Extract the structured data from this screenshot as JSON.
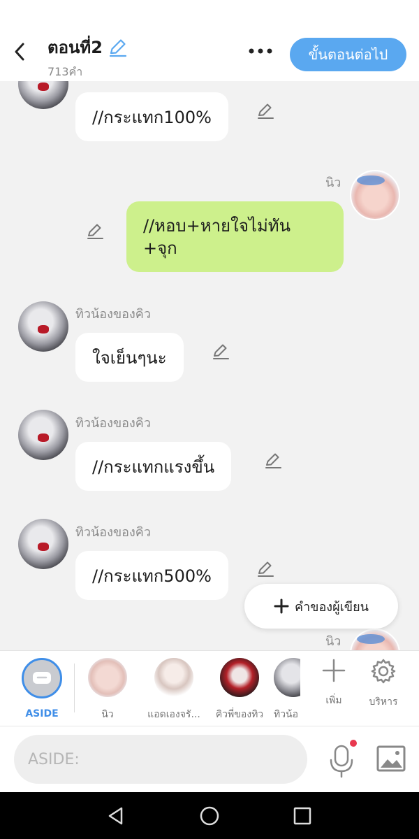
{
  "header": {
    "title": "ตอนที่2",
    "word_count": "713คำ",
    "next_label": "ขั้นตอนต่อไป"
  },
  "messages": [
    {
      "sender": "",
      "text": "//กระแทก100%",
      "side": "left"
    },
    {
      "sender": "นิว",
      "text": "//หอบ+หายใจไม่ทัน\n+จุก",
      "side": "right"
    },
    {
      "sender": "ทิวน้องของคิว",
      "text": "ใจเย็นๆนะ",
      "side": "left"
    },
    {
      "sender": "ทิวน้องของคิว",
      "text": "//กระแทกแรงขึ้น",
      "side": "left"
    },
    {
      "sender": "ทิวน้องของคิว",
      "text": "//กระแทก500%",
      "side": "left"
    },
    {
      "sender": "นิว",
      "text": "",
      "side": "right"
    }
  ],
  "writer_button_label": "คำของผู้เขียน",
  "characters": [
    {
      "label": "ASIDE"
    },
    {
      "label": "นิว"
    },
    {
      "label": "แอดเองจรั..."
    },
    {
      "label": "คิวพี่ของทิว"
    },
    {
      "label": "ทิวน้อ"
    }
  ],
  "tools": {
    "add_label": "เพิ่ม",
    "manage_label": "บริหาร"
  },
  "input": {
    "placeholder": "ASIDE:"
  },
  "colors": {
    "accent": "#5aa8f0",
    "my_bubble": "#cdf08c",
    "aside_ring": "#3f8ee8",
    "mic_dot": "#e8384f"
  }
}
